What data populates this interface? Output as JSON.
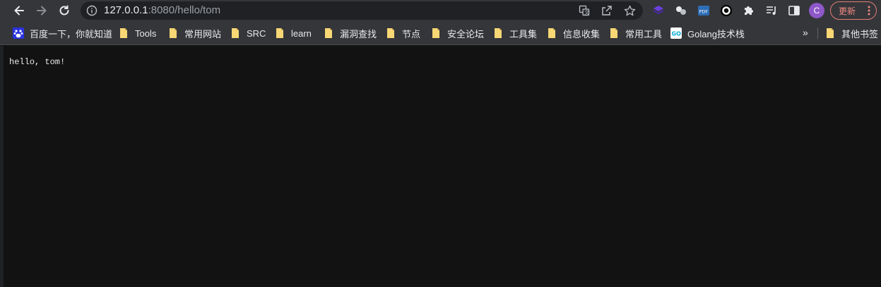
{
  "toolbar": {
    "url_host": "127.0.0.1",
    "url_path": ":8080/hello/tom",
    "avatar_letter": "C",
    "update_label": "更新"
  },
  "bookmarks": [
    {
      "label": "百度一下，你就知道",
      "icon": "baidu-icon"
    },
    {
      "label": "Tools",
      "icon": "folder-icon"
    },
    {
      "label": "常用网站",
      "icon": "folder-icon"
    },
    {
      "label": "SRC",
      "icon": "folder-icon"
    },
    {
      "label": "learn",
      "icon": "folder-icon"
    },
    {
      "label": "漏洞查找",
      "icon": "folder-icon"
    },
    {
      "label": "节点",
      "icon": "folder-icon"
    },
    {
      "label": "安全论坛",
      "icon": "folder-icon"
    },
    {
      "label": "工具集",
      "icon": "folder-icon"
    },
    {
      "label": "信息收集",
      "icon": "folder-icon"
    },
    {
      "label": "常用工具",
      "icon": "folder-icon"
    },
    {
      "label": "Golang技术栈",
      "icon": "go-icon"
    },
    {
      "label": "其他书签",
      "icon": "folder-icon"
    }
  ],
  "bookmarks_overflow": "»",
  "page": {
    "text": "hello, tom!"
  },
  "colors": {
    "toolbar_bg": "#35363a",
    "omnibox_bg": "#202124",
    "page_bg": "#121212",
    "update_accent": "#f28b82",
    "avatar_bg": "#8e58c9",
    "folder_yellow": "#f8d775"
  }
}
